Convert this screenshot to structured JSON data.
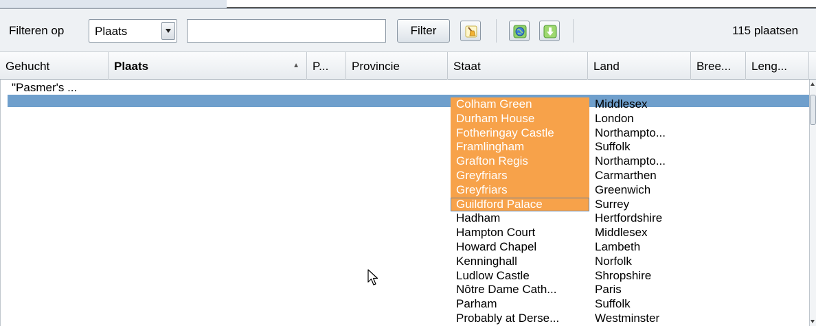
{
  "toolbar": {
    "filter_label": "Filteren op",
    "filter_field_selected": "Plaats",
    "filter_input_value": "",
    "filter_button": "Filter",
    "count_text": "115 plaatsen"
  },
  "colors": {
    "selection_row": "#6f9fcc",
    "highlight_cell": "#f7a24a",
    "toolbar_bg": "#eef1f4"
  },
  "icons": {
    "clear_filter": "broom-icon",
    "globe": "globe-icon",
    "download": "download-arrow-icon"
  },
  "table": {
    "columns": [
      "Gehucht",
      "Plaats",
      "P...",
      "Provincie",
      "Staat",
      "Land",
      "Bree...",
      "Leng..."
    ],
    "sorted_column": "Plaats",
    "sort_direction": "ascending",
    "first_row_gehucht": "\"Pasmer's ...",
    "staat_items": [
      "Colham Green",
      "Durham House",
      "Fotheringay Castle",
      "Framlingham",
      "Grafton Regis",
      "Greyfriars",
      "Greyfriars",
      "Guildford Palace",
      "Hadham",
      "Hampton Court",
      "Howard Chapel",
      "Kenninghall",
      "Ludlow Castle",
      "Nôtre Dame Cath...",
      "Parham",
      "Probably at Derse..."
    ],
    "land_items": [
      "Middlesex",
      "London",
      "Northampto...",
      "Suffolk",
      "Northampto...",
      "Carmarthen",
      "Greenwich",
      "Surrey",
      "Hertfordshire",
      "Middlesex",
      "Lambeth",
      "Norfolk",
      "Shropshire",
      "Paris",
      "Suffolk",
      "Westminster"
    ]
  }
}
